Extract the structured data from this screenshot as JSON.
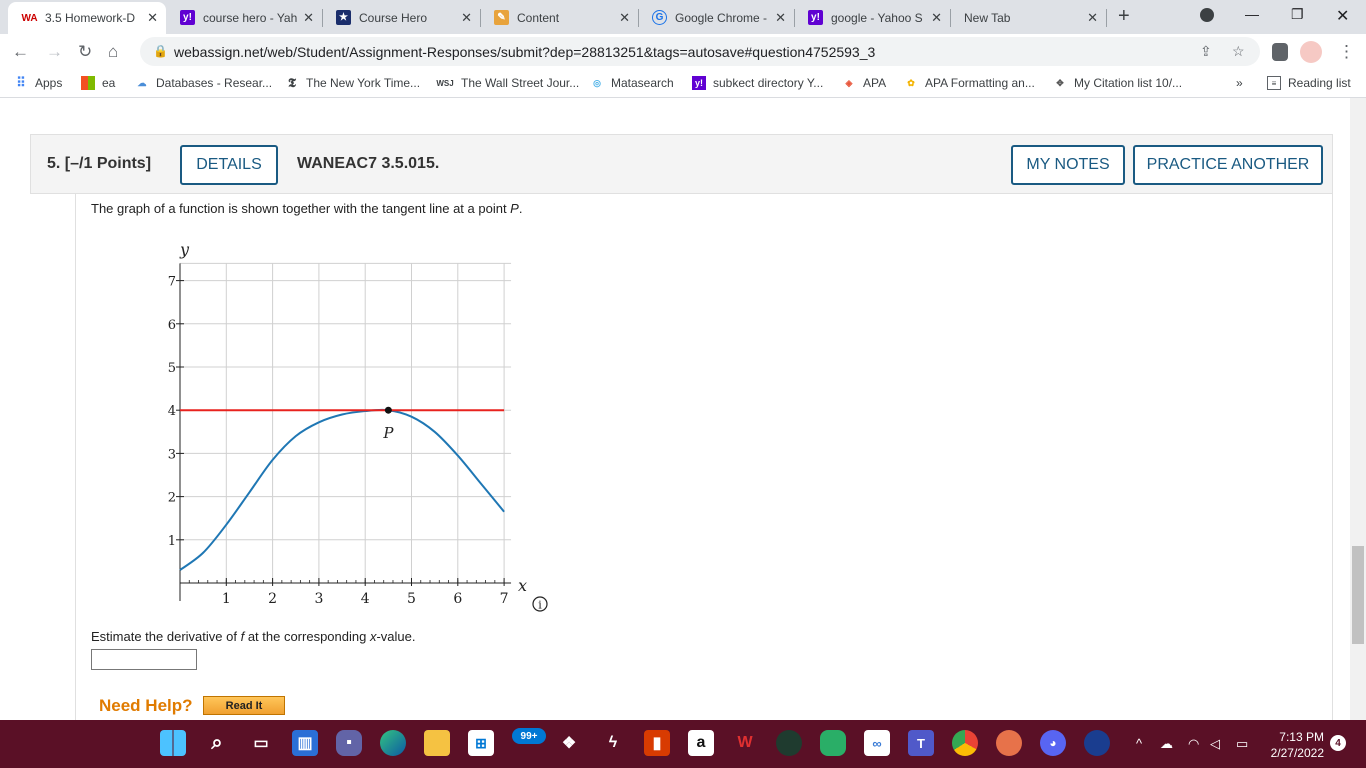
{
  "browser": {
    "tabs": [
      {
        "title": "3.5 Homework-D",
        "fav": "WA",
        "favcolor": "#c00"
      },
      {
        "title": "course hero - Yah",
        "fav": "y!",
        "favcolor": "#6001d2"
      },
      {
        "title": "Course Hero",
        "fav": "★",
        "favcolor": "#1a2d6b"
      },
      {
        "title": "Content",
        "fav": "✎",
        "favcolor": "#e8a33c"
      },
      {
        "title": "Google Chrome -",
        "fav": "G",
        "favcolor": "#1a73e8"
      },
      {
        "title": "google - Yahoo S",
        "fav": "y!",
        "favcolor": "#6001d2"
      },
      {
        "title": "New Tab",
        "fav": "",
        "favcolor": "#dee1e6"
      }
    ],
    "url": "webassign.net/web/Student/Assignment-Responses/submit?dep=28813251&tags=autosave#question4752593_3",
    "bookmarks": [
      {
        "label": "Apps",
        "icon": "apps-icon"
      },
      {
        "label": "ea",
        "icon": "ea-icon"
      },
      {
        "label": "Databases - Resear...",
        "icon": "cloud-icon"
      },
      {
        "label": "The New York Time...",
        "icon": "nyt-icon"
      },
      {
        "label": "The Wall Street Jour...",
        "icon": "wsj-icon"
      },
      {
        "label": "Matasearch",
        "icon": "matasearch-icon"
      },
      {
        "label": "subkect directory Y...",
        "icon": "yahoo-icon"
      },
      {
        "label": "APA",
        "icon": "apa-icon"
      },
      {
        "label": "APA Formatting an...",
        "icon": "apa-formatting-icon"
      },
      {
        "label": "My Citation list 10/...",
        "icon": "citation-icon"
      }
    ],
    "more_bookmarks": "»",
    "reading_list": "Reading list"
  },
  "question": {
    "number": "5.",
    "points": "[–/1 Points]",
    "details_label": "DETAILS",
    "code": "WANEAC7 3.5.015.",
    "my_notes_label": "MY NOTES",
    "practice_label": "PRACTICE ANOTHER",
    "prompt_pre": "The graph of a function is shown together with the tangent line at a point ",
    "prompt_var": "P",
    "prompt_post": ".",
    "estimate_pre": "Estimate the derivative of ",
    "estimate_f": "f",
    "estimate_mid": " at the corresponding ",
    "estimate_x": "x",
    "estimate_post": "-value.",
    "answer_value": "",
    "need_help": "Need Help?",
    "read_it": "Read It"
  },
  "chart_data": {
    "type": "line",
    "title": "",
    "xlabel": "x",
    "ylabel": "y",
    "xlim": [
      0,
      7
    ],
    "ylim": [
      0,
      7
    ],
    "xticks": [
      1,
      2,
      3,
      4,
      5,
      6,
      7
    ],
    "yticks": [
      1,
      2,
      3,
      4,
      5,
      6,
      7
    ],
    "grid": true,
    "point_label": "P",
    "point": [
      4.5,
      4
    ],
    "series": [
      {
        "color": "#1f77b4",
        "x": [
          0,
          0.5,
          1,
          1.5,
          2,
          2.5,
          3,
          3.5,
          4,
          4.5,
          5,
          5.5,
          6,
          6.5,
          7
        ],
        "y": [
          0.3,
          0.7,
          1.35,
          2.1,
          2.85,
          3.4,
          3.72,
          3.9,
          3.98,
          4.0,
          3.85,
          3.5,
          2.95,
          2.3,
          1.65
        ]
      },
      {
        "color": "#e8221e",
        "x": [
          0,
          7
        ],
        "y": [
          4,
          4
        ]
      }
    ]
  },
  "taskbar": {
    "apps": [
      "windows-icon",
      "search-icon",
      "task-view-icon",
      "widgets-icon",
      "teams-chat-icon",
      "edge-icon",
      "file-explorer-icon",
      "store-icon",
      "dropbox-icon",
      "bolt-icon",
      "office-icon",
      "amazon-icon",
      "wps-icon",
      "edge-dev-icon",
      "wechat-icon",
      "app-icon",
      "teams-icon",
      "chrome-icon",
      "discord-icon",
      "app2-icon"
    ],
    "badge_count": "99+",
    "time": "7:13 PM",
    "date": "2/27/2022",
    "notification_count": "4"
  }
}
